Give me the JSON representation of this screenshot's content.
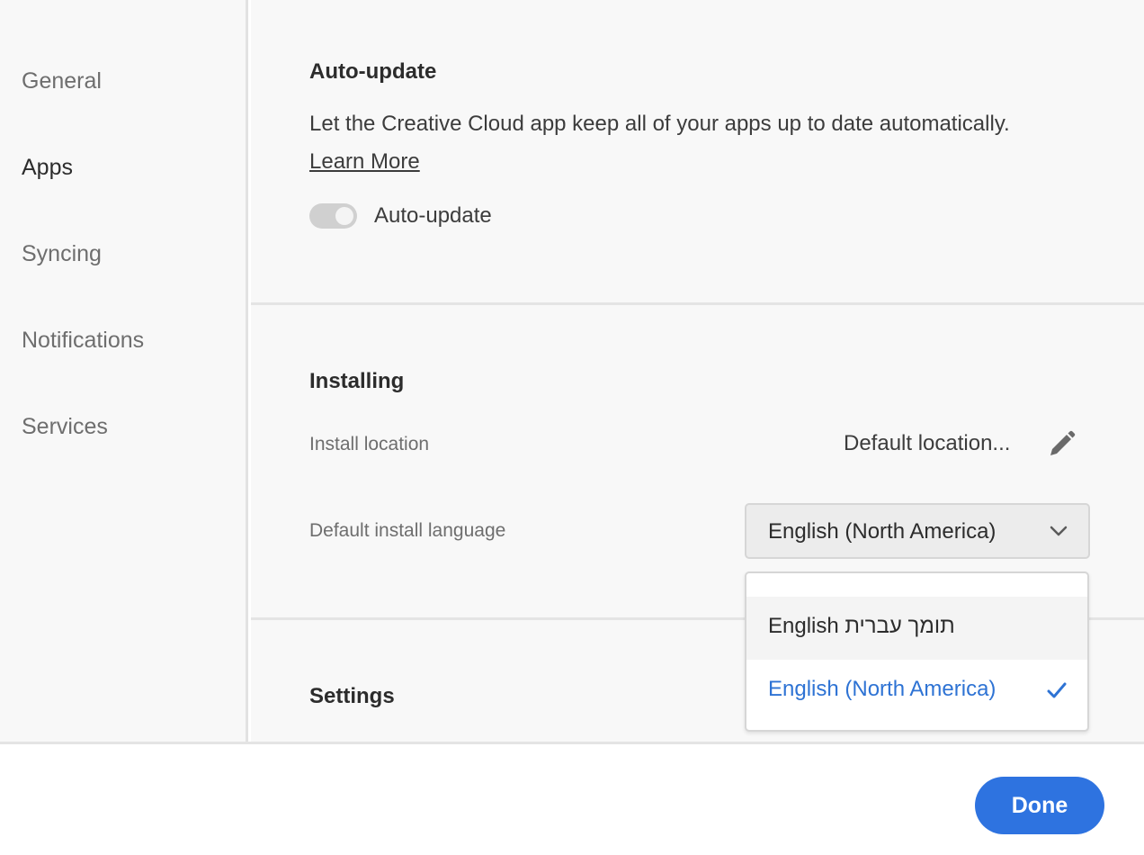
{
  "sidebar": {
    "items": [
      {
        "label": "General",
        "active": false
      },
      {
        "label": "Apps",
        "active": true
      },
      {
        "label": "Syncing",
        "active": false
      },
      {
        "label": "Notifications",
        "active": false
      },
      {
        "label": "Services",
        "active": false
      }
    ]
  },
  "auto_update": {
    "title": "Auto-update",
    "description": "Let the Creative Cloud app keep all of your apps up to date automatically.",
    "learn_more": "Learn More",
    "toggle_label": "Auto-update",
    "toggle_on": false
  },
  "installing": {
    "title": "Installing",
    "install_location_label": "Install location",
    "install_location_value": "Default location...",
    "language_label": "Default install language",
    "language_selected": "English (North America)",
    "language_options": [
      {
        "label": "English תומך עברית",
        "selected": false
      },
      {
        "label": "English (North America)",
        "selected": true
      }
    ]
  },
  "settings": {
    "title": "Settings"
  },
  "footer": {
    "done_label": "Done"
  },
  "colors": {
    "accent": "#2e73e0",
    "selected_text": "#2e73d4",
    "sidebar_bg": "#f8f8f8"
  },
  "icons": {
    "edit": "pencil-icon",
    "dropdown": "chevron-down-icon",
    "selected": "checkmark-icon"
  }
}
